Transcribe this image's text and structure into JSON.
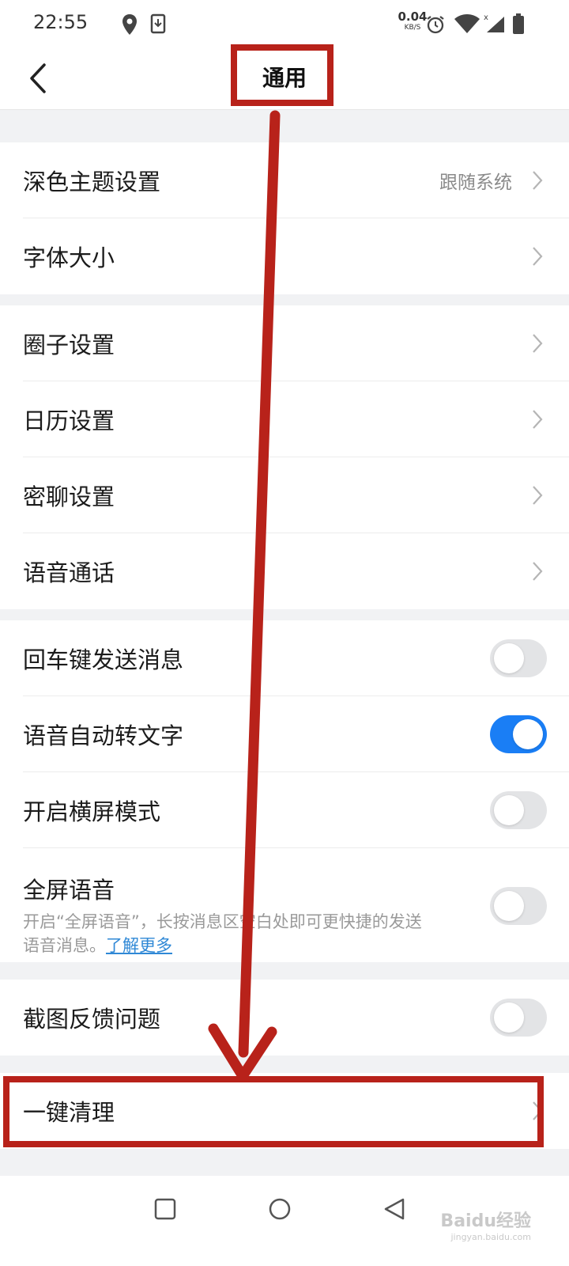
{
  "status_bar": {
    "time": "22:55",
    "net_speed_value": "0.04",
    "net_speed_unit": "KB/S",
    "icons": [
      "location-icon",
      "download-icon",
      "alarm-icon",
      "wifi-icon",
      "signal-icon",
      "battery-icon"
    ]
  },
  "title_bar": {
    "title": "通用"
  },
  "sections": {
    "display": {
      "dark_theme": {
        "label": "深色主题设置",
        "value": "跟随系统"
      },
      "font_size": {
        "label": "字体大小"
      }
    },
    "features": {
      "circle": {
        "label": "圈子设置"
      },
      "calendar": {
        "label": "日历设置"
      },
      "secret_chat": {
        "label": "密聊设置"
      },
      "voice_call": {
        "label": "语音通话"
      }
    },
    "toggles": {
      "enter_send": {
        "label": "回车键发送消息",
        "on": false
      },
      "voice_to_text": {
        "label": "语音自动转文字",
        "on": true
      },
      "landscape": {
        "label": "开启横屏模式",
        "on": false
      },
      "fullscreen_voice": {
        "label": "全屏语音",
        "description": "开启“全屏语音”，长按消息区空白处即可更快捷的发送语音消息。",
        "link": "了解更多",
        "on": false
      }
    },
    "feedback": {
      "screenshot_feedback": {
        "label": "截图反馈问题",
        "on": false
      }
    },
    "cleanup": {
      "one_key_clean": {
        "label": "一键清理"
      }
    }
  },
  "watermark": {
    "text": "Baidu经验",
    "sub": "jingyan.baidu.com"
  },
  "colors": {
    "accent": "#1a7ef5",
    "annotation": "#b8221a",
    "background": "#f1f2f4"
  }
}
